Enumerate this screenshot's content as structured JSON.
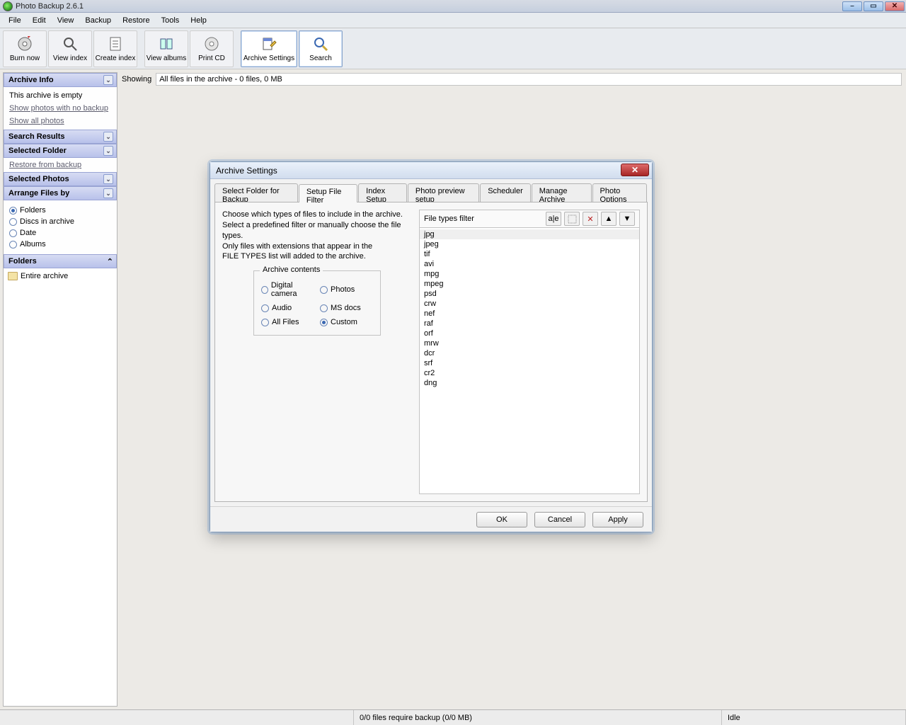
{
  "app": {
    "title": "Photo Backup 2.6.1"
  },
  "menu": {
    "items": [
      "File",
      "Edit",
      "View",
      "Backup",
      "Restore",
      "Tools",
      "Help"
    ]
  },
  "toolbar": {
    "items": [
      {
        "label": "Burn now"
      },
      {
        "label": "View index"
      },
      {
        "label": "Create index"
      },
      {
        "label": "View albums"
      },
      {
        "label": "Print CD"
      },
      {
        "label": "Archive Settings"
      },
      {
        "label": "Search"
      }
    ]
  },
  "sidebar": {
    "archive_info": {
      "title": "Archive Info",
      "body": "This archive is empty",
      "link1": "Show photos with no backup",
      "link2": "Show all photos"
    },
    "search_results": {
      "title": "Search Results"
    },
    "selected_folder": {
      "title": "Selected Folder",
      "link": "Restore from backup"
    },
    "selected_photos": {
      "title": "Selected Photos"
    },
    "arrange": {
      "title": "Arrange Files by",
      "options": [
        "Folders",
        "Discs in archive",
        "Date",
        "Albums"
      ],
      "selected": 0
    },
    "folders": {
      "title": "Folders",
      "entry": "Entire archive"
    }
  },
  "main": {
    "showing_label": "Showing",
    "showing_value": "All files in the archive - 0 files, 0 MB"
  },
  "dialog": {
    "title": "Archive Settings",
    "tabs": [
      "Select Folder for Backup",
      "Setup File Filter",
      "Index Setup",
      "Photo preview setup",
      "Scheduler",
      "Manage Archive",
      "Photo Options"
    ],
    "active_tab": 1,
    "description_lines": [
      "Choose which types of files to include in the archive.",
      "Select a predefined filter or manually choose the file types.",
      "Only files with extensions that appear in the",
      "FILE TYPES list will added to the archive."
    ],
    "group_label": "Archive contents",
    "presets": [
      "Digital camera",
      "Photos",
      "Audio",
      "MS docs",
      "All Files",
      "Custom"
    ],
    "preset_selected": 5,
    "filter_label": "File types filter",
    "icon_tooltips": {
      "edit": "a|e",
      "add": "+",
      "del": "×",
      "up": "↑",
      "down": "↓"
    },
    "extensions": [
      "jpg",
      "jpeg",
      "tif",
      "avi",
      "mpg",
      "mpeg",
      "psd",
      "crw",
      "nef",
      "raf",
      "orf",
      "mrw",
      "dcr",
      "srf",
      "cr2",
      "dng"
    ],
    "ext_selected": 0,
    "buttons": {
      "ok": "OK",
      "cancel": "Cancel",
      "apply": "Apply"
    }
  },
  "status": {
    "center": "0/0 files require backup (0/0 MB)",
    "right": "Idle"
  }
}
